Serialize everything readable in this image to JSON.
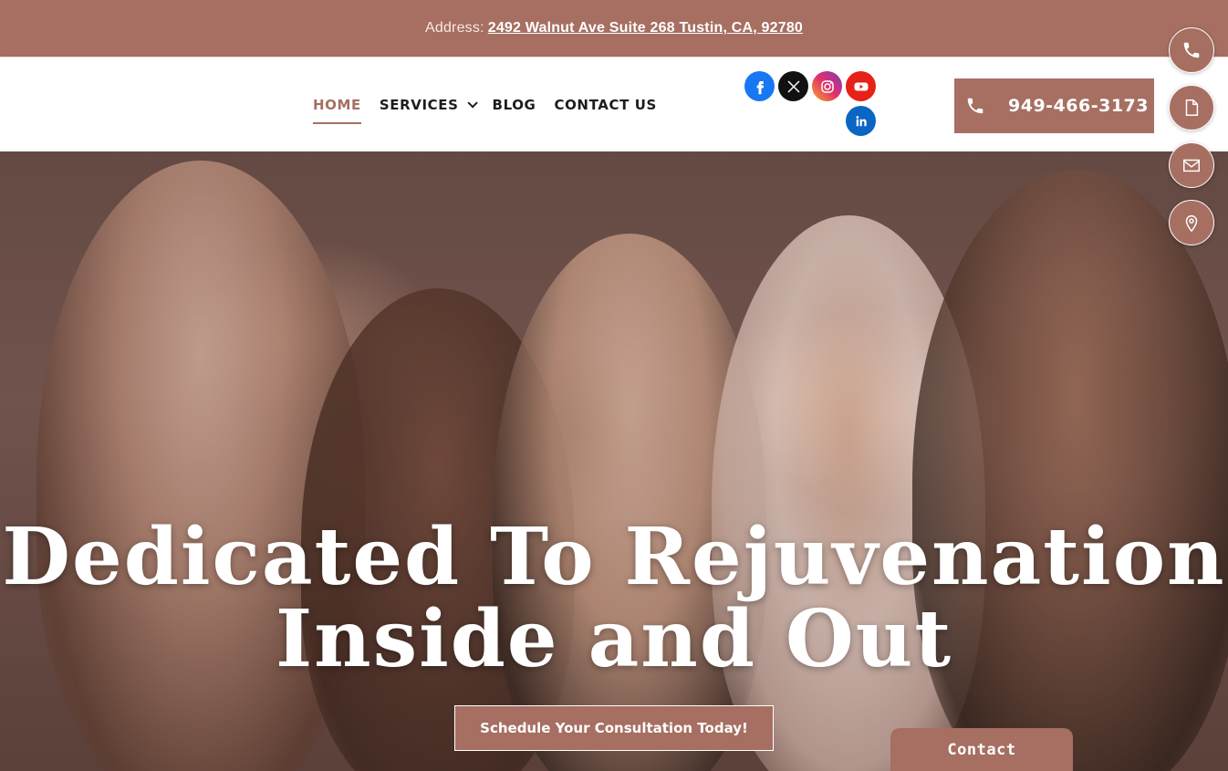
{
  "topbar": {
    "label": "Address:",
    "address": "2492 Walnut Ave Suite 268 Tustin, CA, 92780"
  },
  "nav": {
    "items": [
      {
        "label": "HOME",
        "active": true
      },
      {
        "label": "SERVICES",
        "has_dropdown": true
      },
      {
        "label": "BLOG"
      },
      {
        "label": "CONTACT US"
      }
    ]
  },
  "socials": [
    {
      "name": "facebook-icon",
      "color": "#1877f2"
    },
    {
      "name": "x-twitter-icon",
      "color": "#111111"
    },
    {
      "name": "instagram-icon",
      "color": "#c13584"
    },
    {
      "name": "youtube-icon",
      "color": "#e62117"
    },
    {
      "name": "linkedin-icon",
      "color": "#0a66c2"
    }
  ],
  "header": {
    "phone": "949-466-3173"
  },
  "hero": {
    "title_line1": "Dedicated To Rejuvenation",
    "title_line2": "Inside and Out",
    "cta": "Schedule Your Consultation Today!"
  },
  "contact_tab": {
    "label": "Contact"
  },
  "floating_actions": [
    {
      "name": "phone-icon"
    },
    {
      "name": "document-icon"
    },
    {
      "name": "mail-icon"
    },
    {
      "name": "map-pin-icon"
    }
  ],
  "colors": {
    "accent": "#a66f62",
    "text_dark": "#1d1d1d"
  }
}
